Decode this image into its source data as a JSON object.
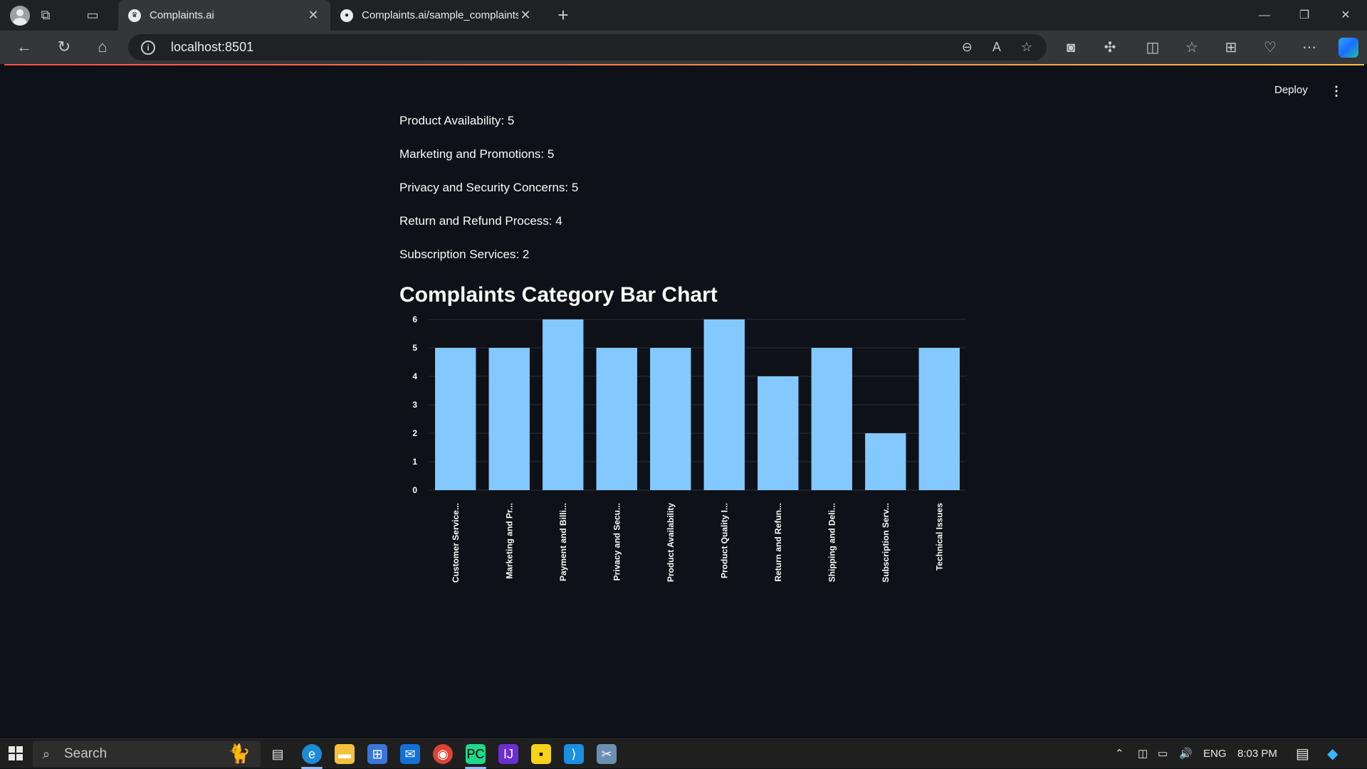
{
  "browser": {
    "tabs": [
      {
        "title": "Complaints.ai",
        "active": true
      },
      {
        "title": "Complaints.ai/sample_complaints",
        "active": false
      }
    ],
    "url": "localhost:8501"
  },
  "app": {
    "deploy_label": "Deploy",
    "counts": [
      "Product Availability: 5",
      "Marketing and Promotions: 5",
      "Privacy and Security Concerns: 5",
      "Return and Refund Process: 4",
      "Subscription Services: 2"
    ],
    "chart_title": "Complaints Category Bar Chart"
  },
  "chart_data": {
    "type": "bar",
    "categories": [
      "Customer Service...",
      "Marketing and Pr...",
      "Payment and Billi...",
      "Privacy and Secu...",
      "Product Availability",
      "Product Quality I...",
      "Return and Refun...",
      "Shipping and Deli...",
      "Subscription Serv...",
      "Technical Issues"
    ],
    "values": [
      5,
      5,
      6,
      5,
      5,
      6,
      4,
      5,
      2,
      5
    ],
    "yticks": [
      0,
      1,
      2,
      3,
      4,
      5,
      6
    ],
    "ylim": [
      0,
      6
    ],
    "bar_color": "#83c9ff",
    "grid": true
  },
  "taskbar": {
    "search_placeholder": "Search",
    "lang": "ENG",
    "time": "8:03 PM"
  }
}
